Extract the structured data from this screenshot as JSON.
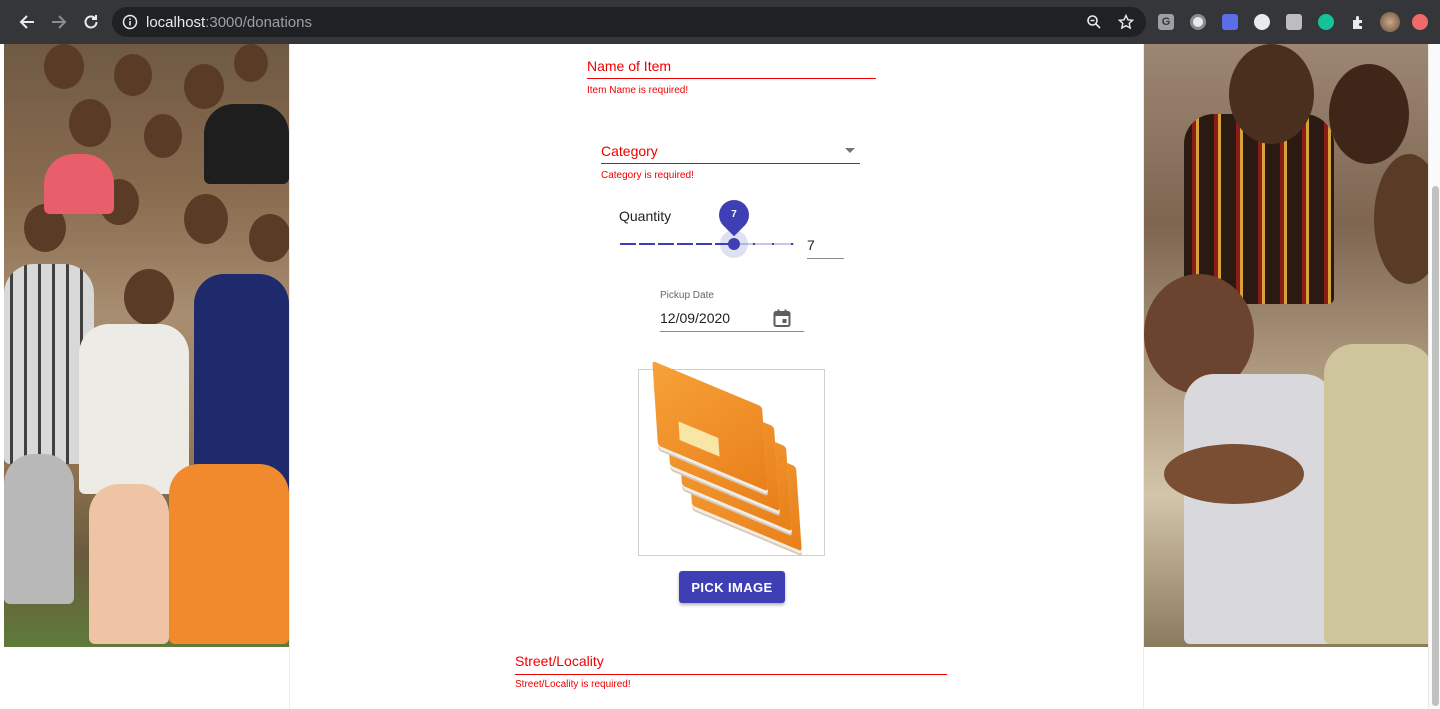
{
  "browser": {
    "url_host": "localhost",
    "url_path": ":3000/donations",
    "extensions": [
      "G",
      "◉",
      "📷",
      "◐",
      "🖹",
      "G",
      "✚",
      "avatar",
      "▲"
    ]
  },
  "form": {
    "name_label": "Name of Item",
    "name_error": "Item Name is required!",
    "category_label": "Category",
    "category_error": "Category is required!",
    "quantity_label": "Quantity",
    "quantity_value": "7",
    "quantity_bubble": "7",
    "quantity_max": 10,
    "pickup_label": "Pickup Date",
    "pickup_value": "12/09/2020",
    "pick_image_button": "PICK IMAGE",
    "street_label": "Street/Locality",
    "street_error": "Street/Locality is required!"
  },
  "colors": {
    "error": "#f00000",
    "primary": "#3f3fb5",
    "chrome": "#35363a"
  }
}
